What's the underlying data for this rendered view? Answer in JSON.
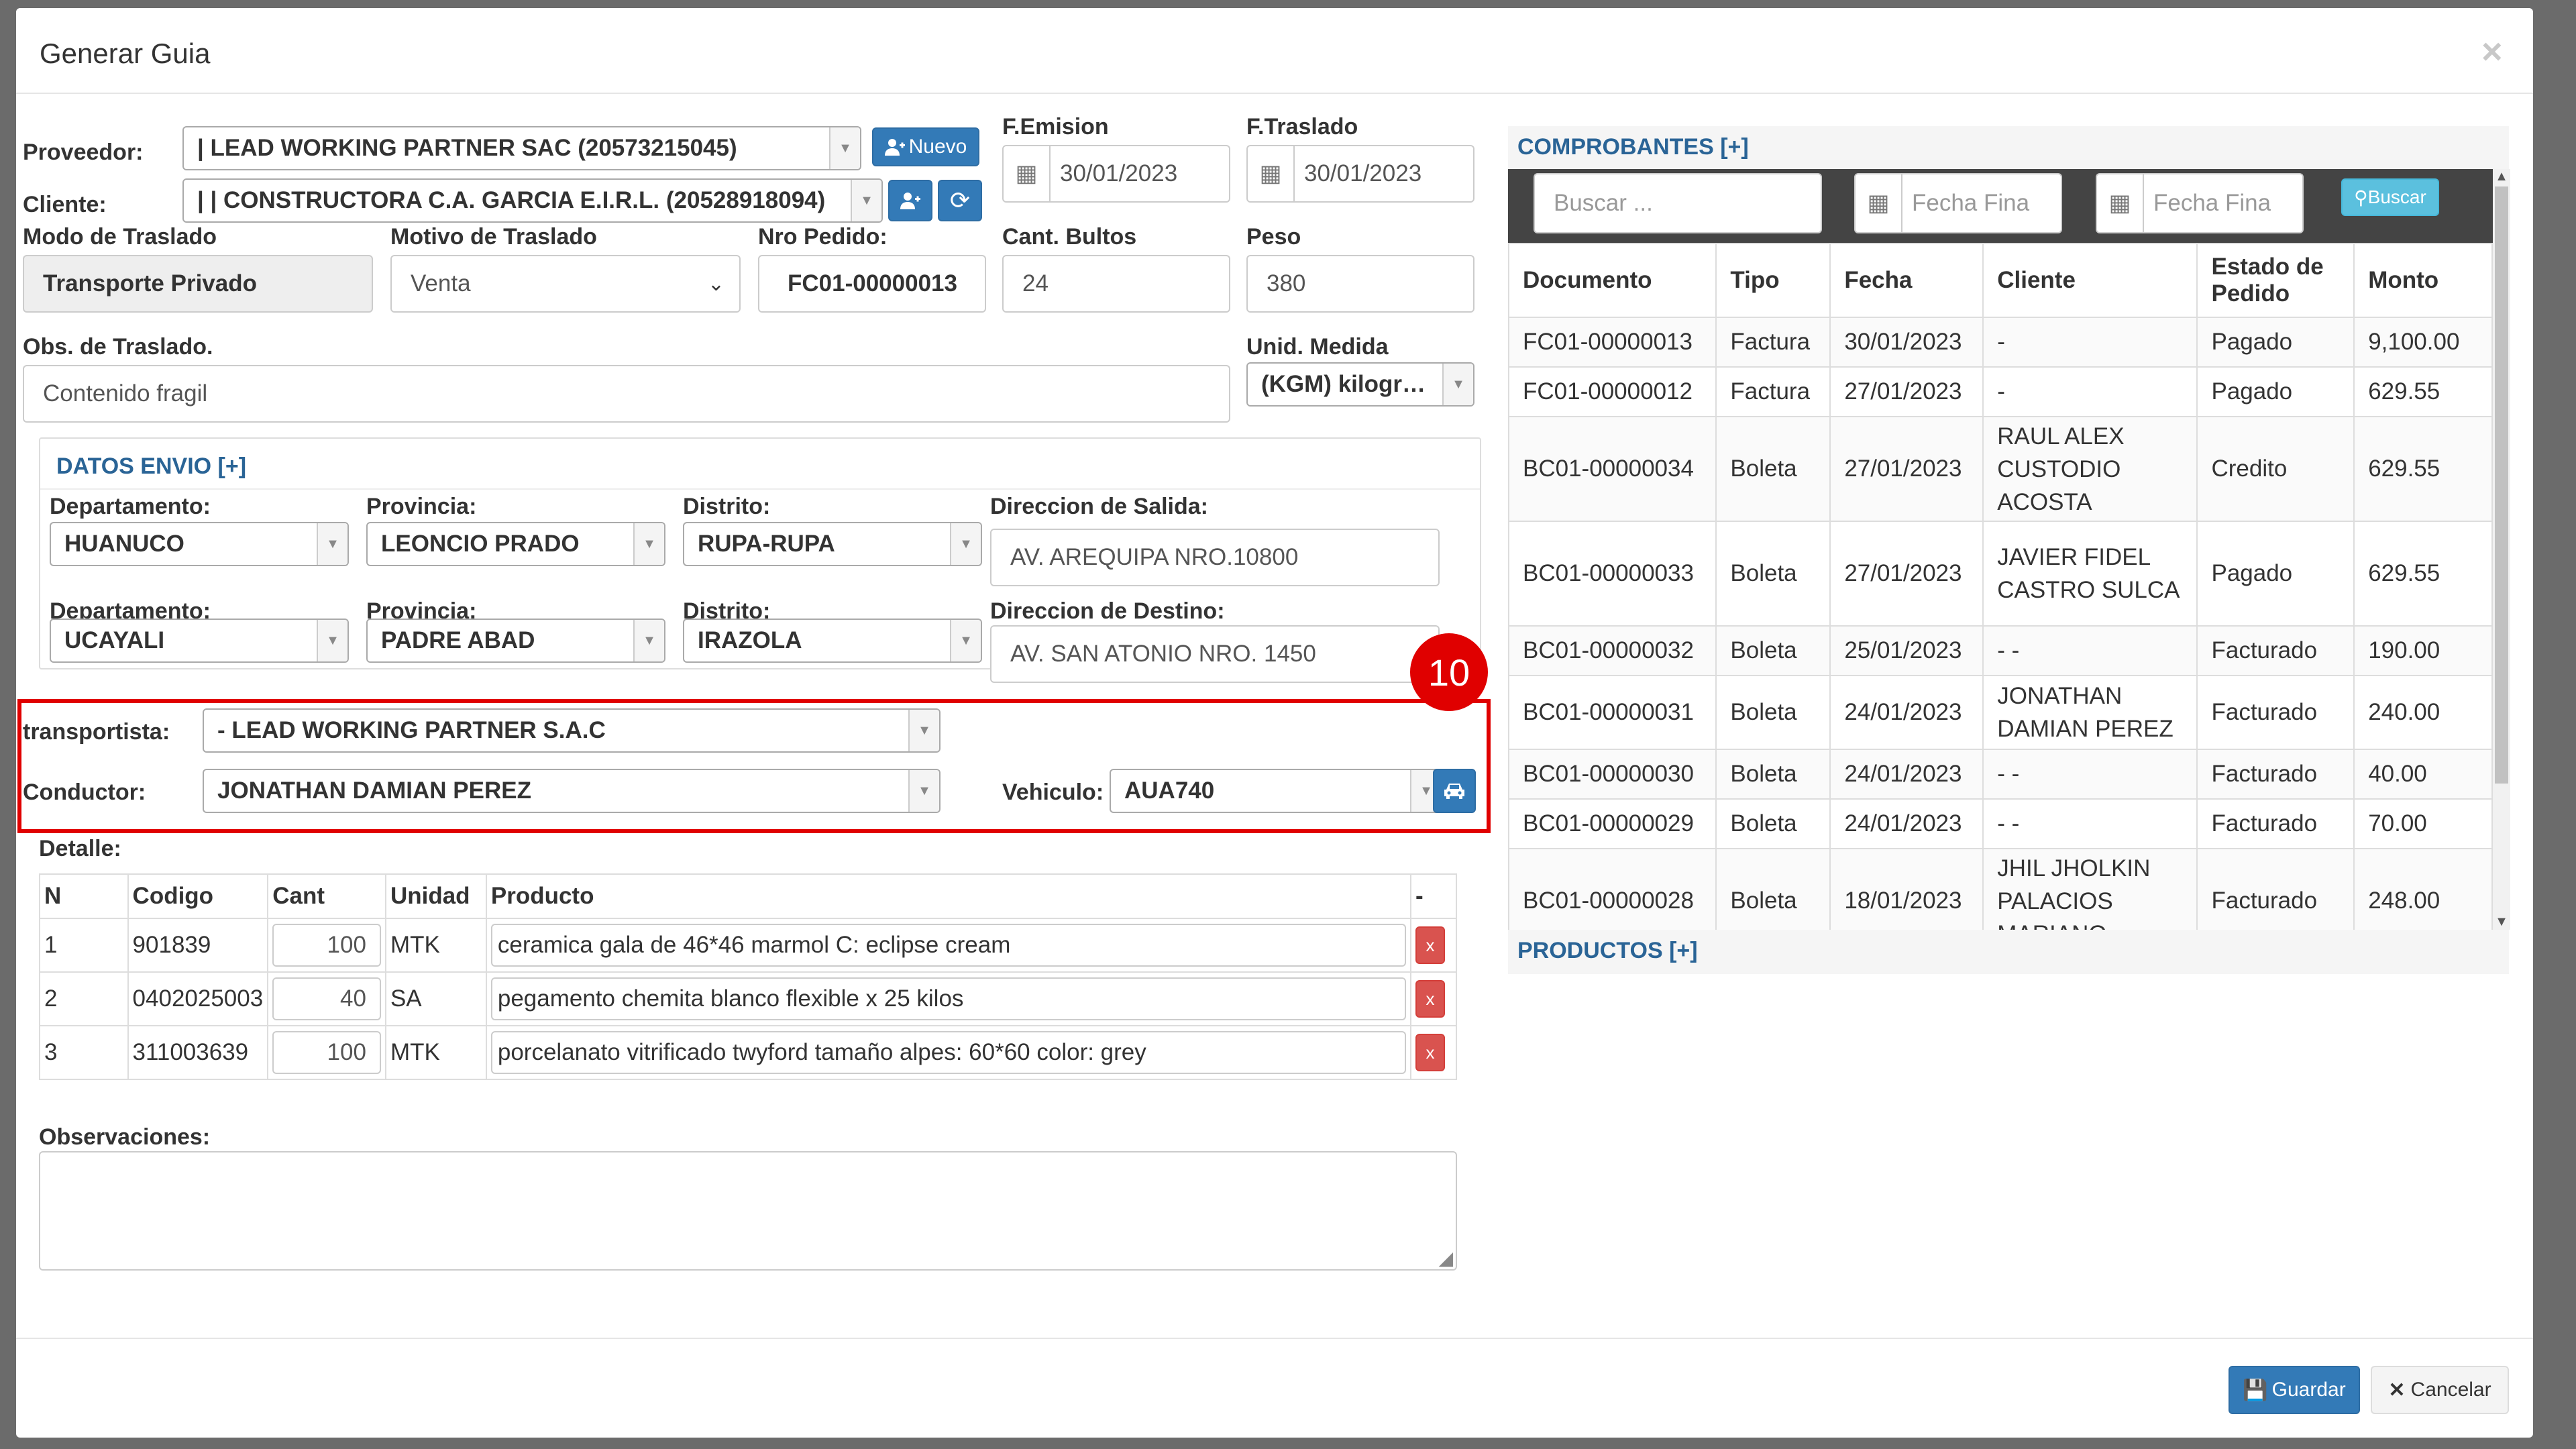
{
  "modal": {
    "title": "Generar Guia",
    "close": "×"
  },
  "form": {
    "proveedor_label": "Proveedor:",
    "proveedor_value": "| LEAD WORKING PARTNER SAC (20573215045)",
    "nuevo_label": "Nuevo",
    "cliente_label": "Cliente:",
    "cliente_value": "| | CONSTRUCTORA C.A. GARCIA E.I.R.L. (20528918094)",
    "femision_label": "F.Emision",
    "femision_value": "30/01/2023",
    "ftraslado_label": "F.Traslado",
    "ftraslado_value": "30/01/2023",
    "modo_label": "Modo de Traslado",
    "modo_value": "Transporte Privado",
    "motivo_label": "Motivo de Traslado",
    "motivo_value": "Venta",
    "pedido_label": "Nro Pedido:",
    "pedido_value": "FC01-00000013",
    "bultos_label": "Cant. Bultos",
    "bultos_value": "24",
    "peso_label": "Peso",
    "peso_value": "380",
    "obs_traslado_label": "Obs. de Traslado.",
    "obs_traslado_value": "Contenido fragil",
    "unidad_label": "Unid. Medida",
    "unidad_value": "(KGM) kilogr…"
  },
  "envio": {
    "title": "DATOS ENVIO [+]",
    "dep_label": "Departamento:",
    "prov_label": "Provincia:",
    "dist_label": "Distrito:",
    "salida_label": "Direccion de Salida:",
    "destino_label": "Direccion de Destino:",
    "dep1": "HUANUCO",
    "prov1": "LEONCIO PRADO",
    "dist1": "RUPA-RUPA",
    "salida": "AV. AREQUIPA NRO.10800",
    "dep2": "UCAYALI",
    "prov2": "PADRE ABAD",
    "dist2": "IRAZOLA",
    "destino": "AV. SAN ATONIO NRO. 1450"
  },
  "badge": "10",
  "transporte": {
    "transportista_label": "transportista:",
    "transportista_value": "- LEAD WORKING PARTNER S.A.C",
    "conductor_label": "Conductor:",
    "conductor_value": "JONATHAN DAMIAN PEREZ",
    "vehiculo_label": "Vehiculo:",
    "vehiculo_value": "AUA740"
  },
  "detalle": {
    "label": "Detalle:",
    "headers": [
      "N",
      "Codigo",
      "Cant",
      "Unidad",
      "Producto",
      "-"
    ],
    "rows": [
      {
        "n": "1",
        "codigo": "901839",
        "cant": "100",
        "unidad": "MTK",
        "producto": "ceramica gala de 46*46 marmol C: eclipse cream"
      },
      {
        "n": "2",
        "codigo": "0402025003",
        "cant": "40",
        "unidad": "SA",
        "producto": "pegamento chemita blanco flexible x 25 kilos"
      },
      {
        "n": "3",
        "codigo": "311003639",
        "cant": "100",
        "unidad": "MTK",
        "producto": "porcelanato vitrificado twyford tamaño alpes: 60*60 color: grey"
      }
    ],
    "delete": "x"
  },
  "observaciones_label": "Observaciones:",
  "comprobantes": {
    "title": "COMPROBANTES [+]",
    "search_placeholder": "Buscar ...",
    "fecha1_placeholder": "Fecha Fina",
    "fecha2_placeholder": "Fecha Fina",
    "buscar_label": "Buscar",
    "headers": [
      "Documento",
      "Tipo",
      "Fecha",
      "Cliente",
      "Estado de Pedido",
      "Monto"
    ],
    "rows": [
      {
        "doc": "FC01-00000013",
        "tipo": "Factura",
        "fecha": "30/01/2023",
        "cliente": "-",
        "estado": "Pagado",
        "monto": "9,100.00"
      },
      {
        "doc": "FC01-00000012",
        "tipo": "Factura",
        "fecha": "27/01/2023",
        "cliente": "-",
        "estado": "Pagado",
        "monto": "629.55"
      },
      {
        "doc": "BC01-00000034",
        "tipo": "Boleta",
        "fecha": "27/01/2023",
        "cliente": "RAUL ALEX CUSTODIO ACOSTA",
        "estado": "Credito",
        "monto": "629.55"
      },
      {
        "doc": "BC01-00000033",
        "tipo": "Boleta",
        "fecha": "27/01/2023",
        "cliente": "JAVIER FIDEL CASTRO SULCA",
        "estado": "Pagado",
        "monto": "629.55"
      },
      {
        "doc": "BC01-00000032",
        "tipo": "Boleta",
        "fecha": "25/01/2023",
        "cliente": "- -",
        "estado": "Facturado",
        "monto": "190.00"
      },
      {
        "doc": "BC01-00000031",
        "tipo": "Boleta",
        "fecha": "24/01/2023",
        "cliente": "JONATHAN DAMIAN PEREZ",
        "estado": "Facturado",
        "monto": "240.00"
      },
      {
        "doc": "BC01-00000030",
        "tipo": "Boleta",
        "fecha": "24/01/2023",
        "cliente": "- -",
        "estado": "Facturado",
        "monto": "40.00"
      },
      {
        "doc": "BC01-00000029",
        "tipo": "Boleta",
        "fecha": "24/01/2023",
        "cliente": "- -",
        "estado": "Facturado",
        "monto": "70.00"
      },
      {
        "doc": "BC01-00000028",
        "tipo": "Boleta",
        "fecha": "18/01/2023",
        "cliente": "JHIL JHOLKIN PALACIOS MARIANO",
        "estado": "Facturado",
        "monto": "248.00"
      }
    ]
  },
  "productos_title": "PRODUCTOS [+]",
  "footer": {
    "guardar": "Guardar",
    "cancelar": "Cancelar"
  }
}
